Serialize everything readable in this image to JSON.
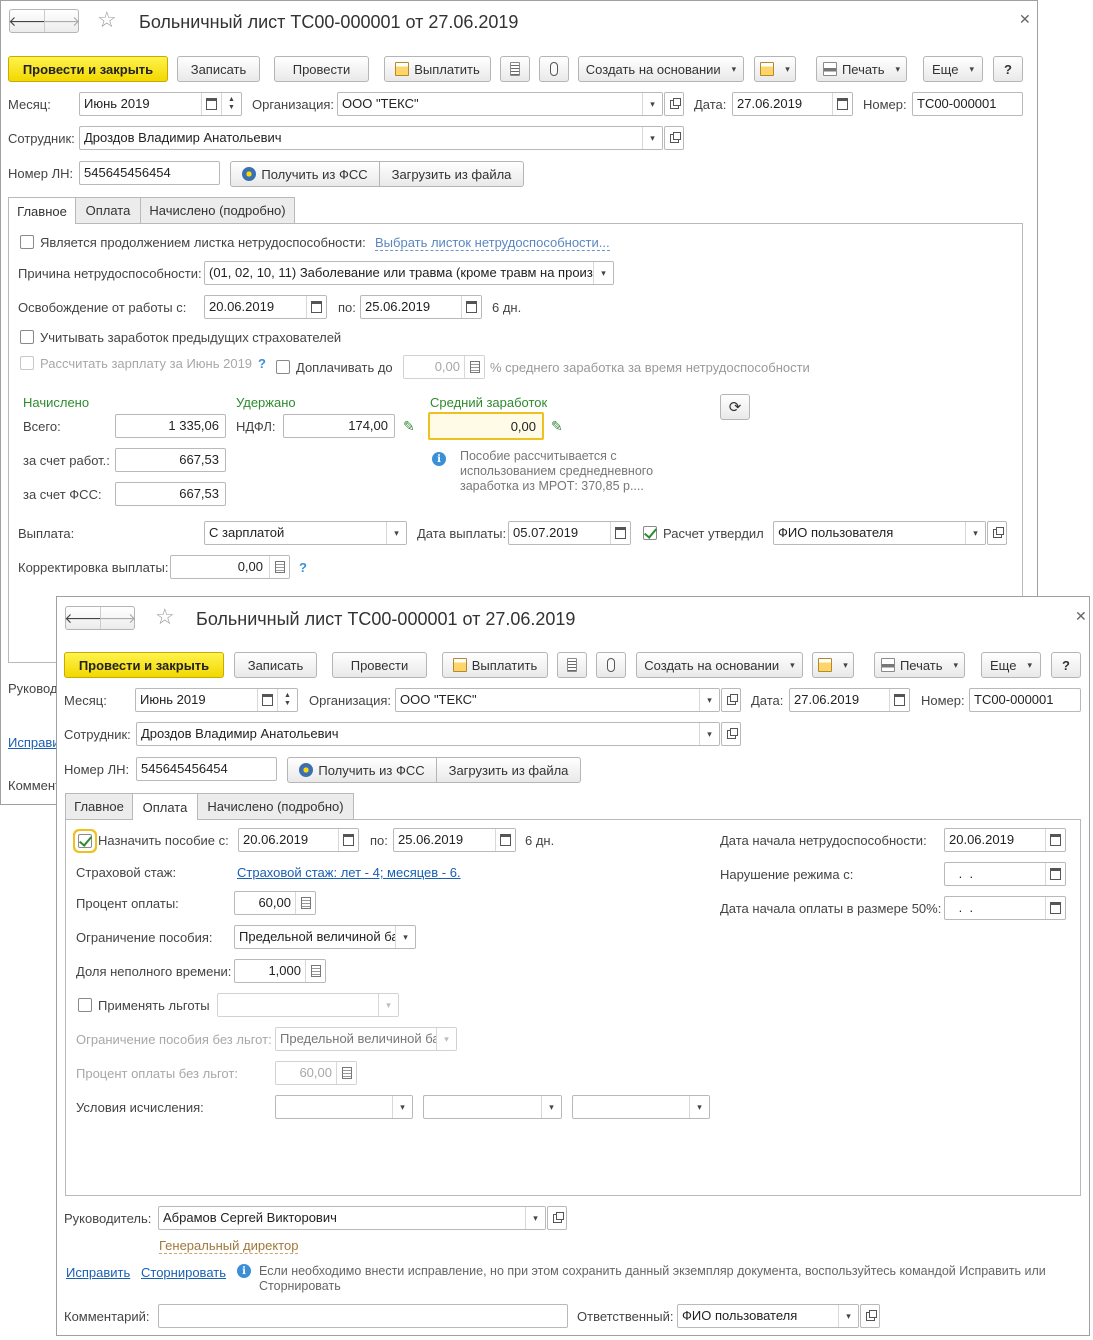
{
  "back_window": {
    "title": "Больничный лист ТС00-000001 от 27.06.2019",
    "toolbar": {
      "post_close": "Провести и закрыть",
      "save": "Записать",
      "post": "Провести",
      "pay": "Выплатить",
      "create_based": "Создать на основании",
      "print": "Печать",
      "more": "Еще",
      "help": "?"
    },
    "header": {
      "month_label": "Месяц:",
      "month_value": "Июнь 2019",
      "org_label": "Организация:",
      "org_value": "ООО \"ТЕКС\"",
      "date_label": "Дата:",
      "date_value": "27.06.2019",
      "number_label": "Номер:",
      "number_value": "ТС00-000001",
      "employee_label": "Сотрудник:",
      "employee_value": "Дроздов Владимир Анатольевич",
      "ln_label": "Номер ЛН:",
      "ln_value": "545645456454",
      "get_fss": "Получить из ФСС",
      "load_file": "Загрузить из файла"
    },
    "tabs": [
      "Главное",
      "Оплата",
      "Начислено (подробно)"
    ],
    "main": {
      "continuation_label": "Является продолжением листка нетрудоспособности:",
      "choose_sheet_link": "Выбрать листок нетрудоспособности...",
      "reason_label": "Причина нетрудоспособности:",
      "reason_value": "(01, 02, 10, 11) Заболевание или травма (кроме травм на произв",
      "release_label": "Освобождение от работы с:",
      "release_from": "20.06.2019",
      "release_to_label": "по:",
      "release_to": "25.06.2019",
      "release_days": "6 дн.",
      "prev_insurers_label": "Учитывать заработок предыдущих страхователей",
      "calc_salary_label": "Рассчитать зарплату за Июнь 2019",
      "help_q": "?",
      "pay_up_to_label": "Доплачивать до",
      "pay_up_to_value": "0,00",
      "pay_up_to_suffix": "% среднего заработка за время нетрудоспособности",
      "accrued_title": "Начислено",
      "withheld_title": "Удержано",
      "avg_title": "Средний заработок",
      "total_label": "Всего:",
      "total_value": "1 335,06",
      "ndfl_label": "НДФЛ:",
      "ndfl_value": "174,00",
      "avg_value": "0,00",
      "employer_label": "за счет работ.:",
      "employer_value": "667,53",
      "fss_label": "за счет ФСС:",
      "fss_value": "667,53",
      "note": "Пособие рассчитывается с использованием среднедневного заработка из МРОТ: 370,85 р....",
      "payment_label": "Выплата:",
      "payment_value": "С зарплатой",
      "pay_date_label": "Дата выплаты:",
      "pay_date_value": "05.07.2019",
      "approved_label": "Расчет утвердил",
      "approved_value": "ФИО пользователя",
      "correction_label": "Корректировка выплаты:",
      "correction_value": "0,00",
      "head_cut": "Руковод",
      "fix_cut": "Исправи",
      "comment_cut": "Коммент"
    }
  },
  "front_window": {
    "title": "Больничный лист ТС00-000001 от 27.06.2019",
    "toolbar": {
      "post_close": "Провести и закрыть",
      "save": "Записать",
      "post": "Провести",
      "pay": "Выплатить",
      "create_based": "Создать на основании",
      "print": "Печать",
      "more": "Еще",
      "help": "?"
    },
    "header": {
      "month_label": "Месяц:",
      "month_value": "Июнь 2019",
      "org_label": "Организация:",
      "org_value": "ООО \"ТЕКС\"",
      "date_label": "Дата:",
      "date_value": "27.06.2019",
      "number_label": "Номер:",
      "number_value": "ТС00-000001",
      "employee_label": "Сотрудник:",
      "employee_value": "Дроздов Владимир Анатольевич",
      "ln_label": "Номер ЛН:",
      "ln_value": "545645456454",
      "get_fss": "Получить из ФСС",
      "load_file": "Загрузить из файла"
    },
    "tabs": [
      "Главное",
      "Оплата",
      "Начислено (подробно)"
    ],
    "payment": {
      "assign_label": "Назначить пособие с:",
      "assign_from": "20.06.2019",
      "to_label": "по:",
      "assign_to": "25.06.2019",
      "days": "6 дн.",
      "start_label": "Дата начала нетрудоспособности:",
      "start_value": "20.06.2019",
      "violation_label": "Нарушение режима с:",
      "violation_value": " .  .",
      "half_label": "Дата начала оплаты в размере 50%:",
      "half_value": " .  .",
      "stage_label": "Страховой стаж:",
      "stage_link": "Страховой стаж: лет - 4; месяцев - 6.",
      "percent_label": "Процент оплаты:",
      "percent_value": "60,00",
      "limit_label": "Ограничение пособия:",
      "limit_value": "Предельной величиной ба",
      "part_label": "Доля неполного времени:",
      "part_value": "1,000",
      "benefits_label": "Применять льготы",
      "limit_nb_label": "Ограничение пособия без льгот:",
      "limit_nb_value": "Предельной величиной ба",
      "percent_nb_label": "Процент оплаты без льгот:",
      "percent_nb_value": "60,00",
      "conditions_label": "Условия исчисления:"
    },
    "footer": {
      "head_label": "Руководитель:",
      "head_value": "Абрамов Сергей Викторович",
      "head_position": "Генеральный директор",
      "fix_link": "Исправить",
      "reverse_link": "Сторнировать",
      "fix_note": "Если необходимо внести исправление, но при этом сохранить данный экземпляр документа, воспользуйтесь командой Исправить или Сторнировать",
      "comment_label": "Комментарий:",
      "comment_value": "",
      "responsible_label": "Ответственный:",
      "responsible_value": "ФИО пользователя"
    }
  }
}
